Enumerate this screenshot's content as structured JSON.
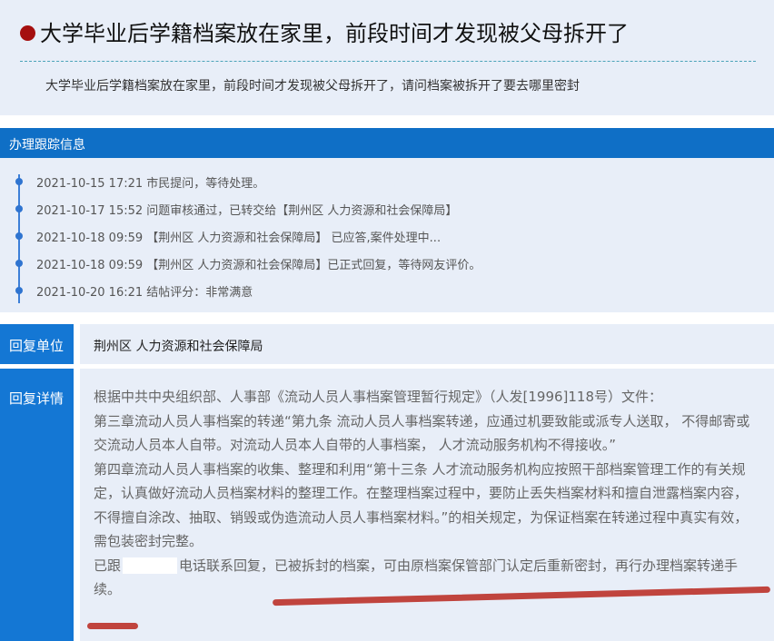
{
  "question": {
    "title": "大学毕业后学籍档案放在家里，前段时间才发现被父母拆开了",
    "description": "大学毕业后学籍档案放在家里，前段时间才发现被父母拆开了，请问档案被拆开了要去哪里密封"
  },
  "tracking": {
    "header": "办理跟踪信息",
    "items": [
      {
        "text": "2021-10-15 17:21 市民提问，等待处理。"
      },
      {
        "text": "2021-10-17 15:52 问题审核通过，已转交给【荆州区 人力资源和社会保障局】"
      },
      {
        "text": "2021-10-18 09:59 【荆州区 人力资源和社会保障局】 已应答,案件处理中..."
      },
      {
        "text": "2021-10-18 09:59 【荆州区 人力资源和社会保障局】已正式回复，等待网友评价。"
      },
      {
        "text": "2021-10-20 16:21 结帖评分：非常满意"
      }
    ]
  },
  "reply": {
    "unit_label": "回复单位",
    "unit_value": "荆州区 人力资源和社会保障局",
    "detail_label": "回复详情",
    "detail_lines": [
      "根据中共中央组织部、人事部《流动人员人事档案管理暂行规定》（人发[1996]118号）文件：",
      "第三章流动人员人事档案的转递“第九条 流动人员人事档案转递，应通过机要致能或派专人送取， 不得邮寄或交流动人员本人自带。对流动人员本人自带的人事档案， 人才流动服务机构不得接收。”",
      "第四章流动人员人事档案的收集、整理和利用“第十三条 人才流动服务机构应按照干部档案管理工作的有关规定，认真做好流动人员档案材料的整理工作。在整理档案过程中，要防止丢失档案材料和擅自泄露档案内容，不得擅自涂改、抽取、销毁或伪造流动人员人事档案材料。”的相关规定，为保证档案在转递过程中真实有效，需包装密封完整。"
    ],
    "last_line_prefix": "已跟",
    "last_line_suffix": "电话联系回复，已被拆封的档案，可由原档案保管部门认定后重新密封，再行办理档案转递手续。"
  }
}
